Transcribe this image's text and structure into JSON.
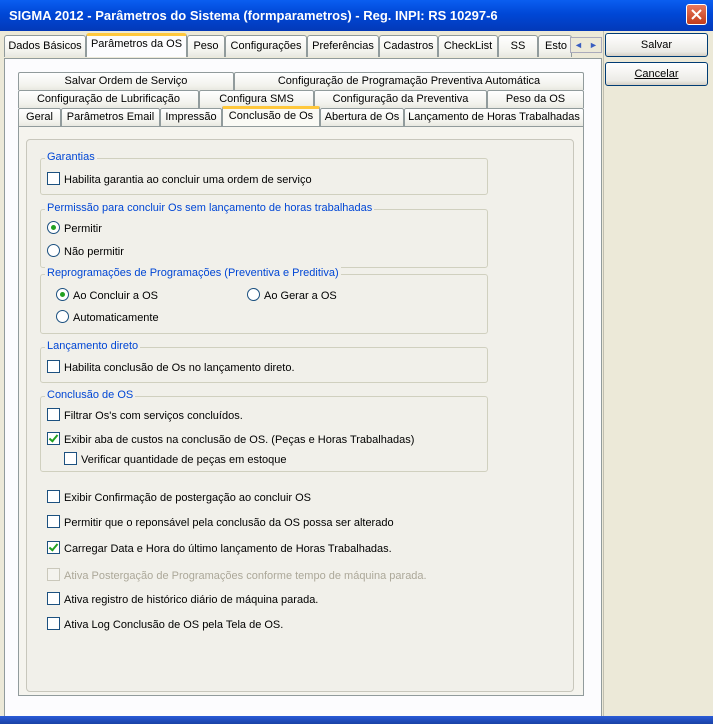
{
  "window": {
    "title": "SIGMA 2012 - Parâmetros do Sistema  (formparametros)  - Reg. INPI: RS 10297-6"
  },
  "main_tabs": [
    "Dados Básicos",
    "Parâmetros da OS",
    "Peso",
    "Configurações",
    "Preferências",
    "Cadastros",
    "CheckList",
    "SS",
    "Esto"
  ],
  "tab_scroll": {
    "left": "◄",
    "right": "►"
  },
  "sub_tabs": {
    "row1": [
      "Salvar Ordem de Serviço",
      "Configuração de Programação Preventiva Automática"
    ],
    "row2": [
      "Configuração de Lubrificação",
      "Configura SMS",
      "Configuração da Preventiva",
      "Peso da OS"
    ],
    "row3": [
      "Geral",
      "Parâmetros Email",
      "Impressão",
      "Conclusão de Os",
      "Abertura de Os",
      "Lançamento de Horas Trabalhadas"
    ]
  },
  "groups": {
    "garantias": {
      "label": "Garantias",
      "option": "Habilita garantia ao concluir uma ordem de serviço",
      "checked": false
    },
    "permissao": {
      "label": "Permissão para concluir Os sem lançamento de horas trabalhadas",
      "options": [
        "Permitir",
        "Não permitir"
      ],
      "selected": "Permitir"
    },
    "reprogramacoes": {
      "label": "Reprogramações de Programações (Preventiva e Preditiva)",
      "options": [
        "Ao Concluir a OS",
        "Ao Gerar a OS",
        "Automaticamente"
      ],
      "selected": "Ao Concluir a OS"
    },
    "lancamento": {
      "label": "Lançamento direto",
      "option": "Habilita conclusão de Os no lançamento direto.",
      "checked": false
    },
    "conclusao": {
      "label": "Conclusão de OS",
      "options": [
        "Filtrar Os's com serviços concluídos.",
        "Exibir aba de custos na conclusão de OS. (Peças e Horas Trabalhadas)",
        "Verificar quantidade de peças em estoque"
      ]
    }
  },
  "standalone_options": [
    "Exibir Confirmação de postergação ao concluir OS",
    "Permitir que o reponsável pela conclusão da OS possa ser alterado",
    "Carregar Data e Hora do último lançamento de Horas Trabalhadas.",
    "Ativa Postergação de Programações conforme tempo de máquina parada.",
    "Ativa registro de histórico diário de máquina parada.",
    "Ativa Log Conclusão de OS pela Tela de OS."
  ],
  "buttons": {
    "save": "Salvar",
    "cancel": "Cancelar"
  },
  "colors": {
    "title_bar": "#0a5ef0",
    "group_label": "#0046d5",
    "active_tab_accent": "#ffc83c",
    "check": "#21a121"
  }
}
